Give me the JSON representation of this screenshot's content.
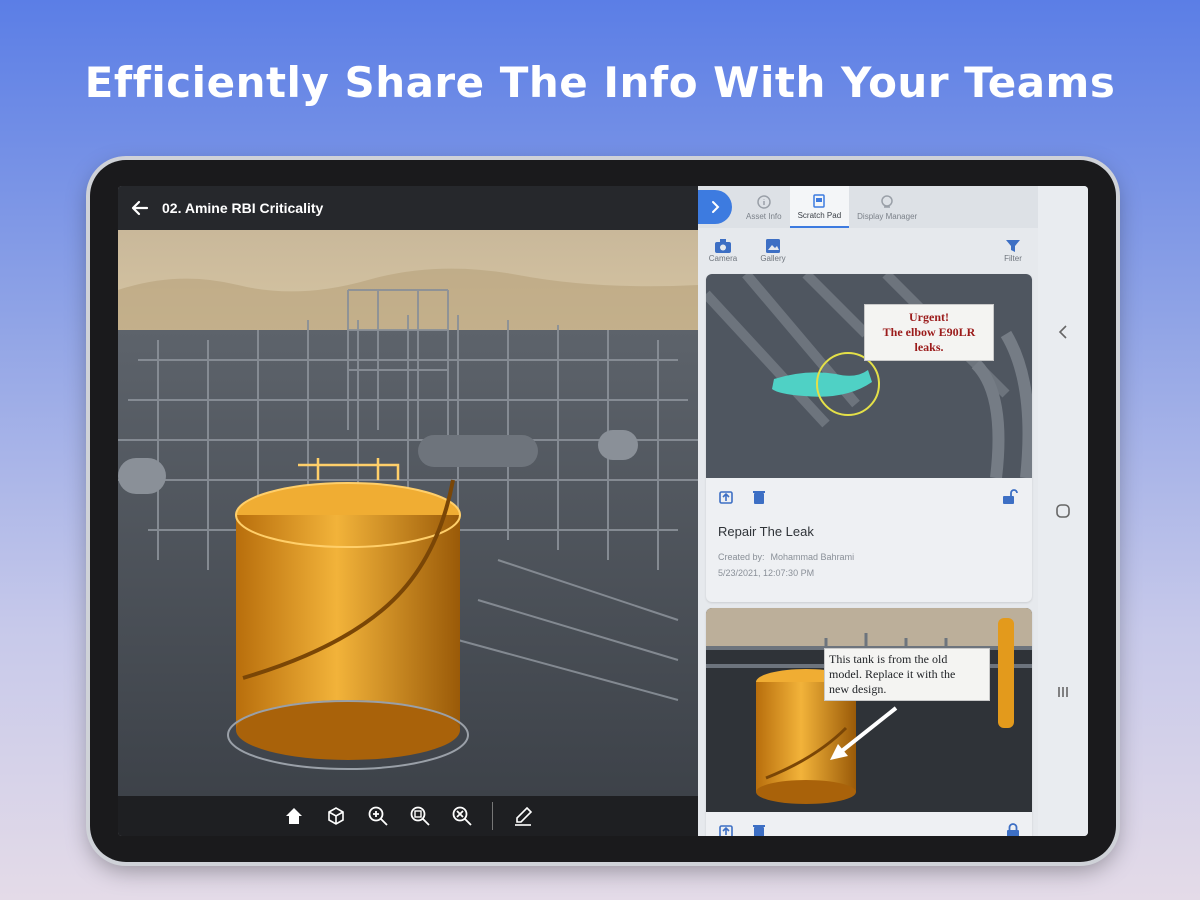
{
  "headline": "Efficiently Share The Info With Your Teams",
  "viewer": {
    "title": "02. Amine RBI Criticality",
    "toolbar": {
      "home": "home-icon",
      "cube": "cube-view-icon",
      "zoom_in": "zoom-in-icon",
      "zoom_fit": "zoom-fit-icon",
      "zoom_out": "zoom-out-icon",
      "markup": "markup-pen-icon"
    }
  },
  "panel": {
    "tabs": [
      {
        "label": "Asset Info"
      },
      {
        "label": "Scratch Pad"
      },
      {
        "label": "Display Manager"
      }
    ],
    "actions": {
      "camera": "Camera",
      "gallery": "Gallery",
      "filter": "Filter"
    },
    "cards": [
      {
        "title": "Repair The Leak",
        "created_label": "Created by:",
        "author": "Mohammad Bahrami",
        "date": "5/23/2021, 12:07:30 PM",
        "note_lines": [
          "Urgent!",
          "The elbow E90LR",
          "leaks."
        ]
      },
      {
        "note_lines": [
          "This tank is from the old",
          "model. Replace it with the",
          "new design."
        ]
      }
    ]
  },
  "colors": {
    "accent": "#3d7be0",
    "tank": "#e39a1c",
    "elbow": "#4fd1c5",
    "urgent_text": "#9b1b1b"
  }
}
